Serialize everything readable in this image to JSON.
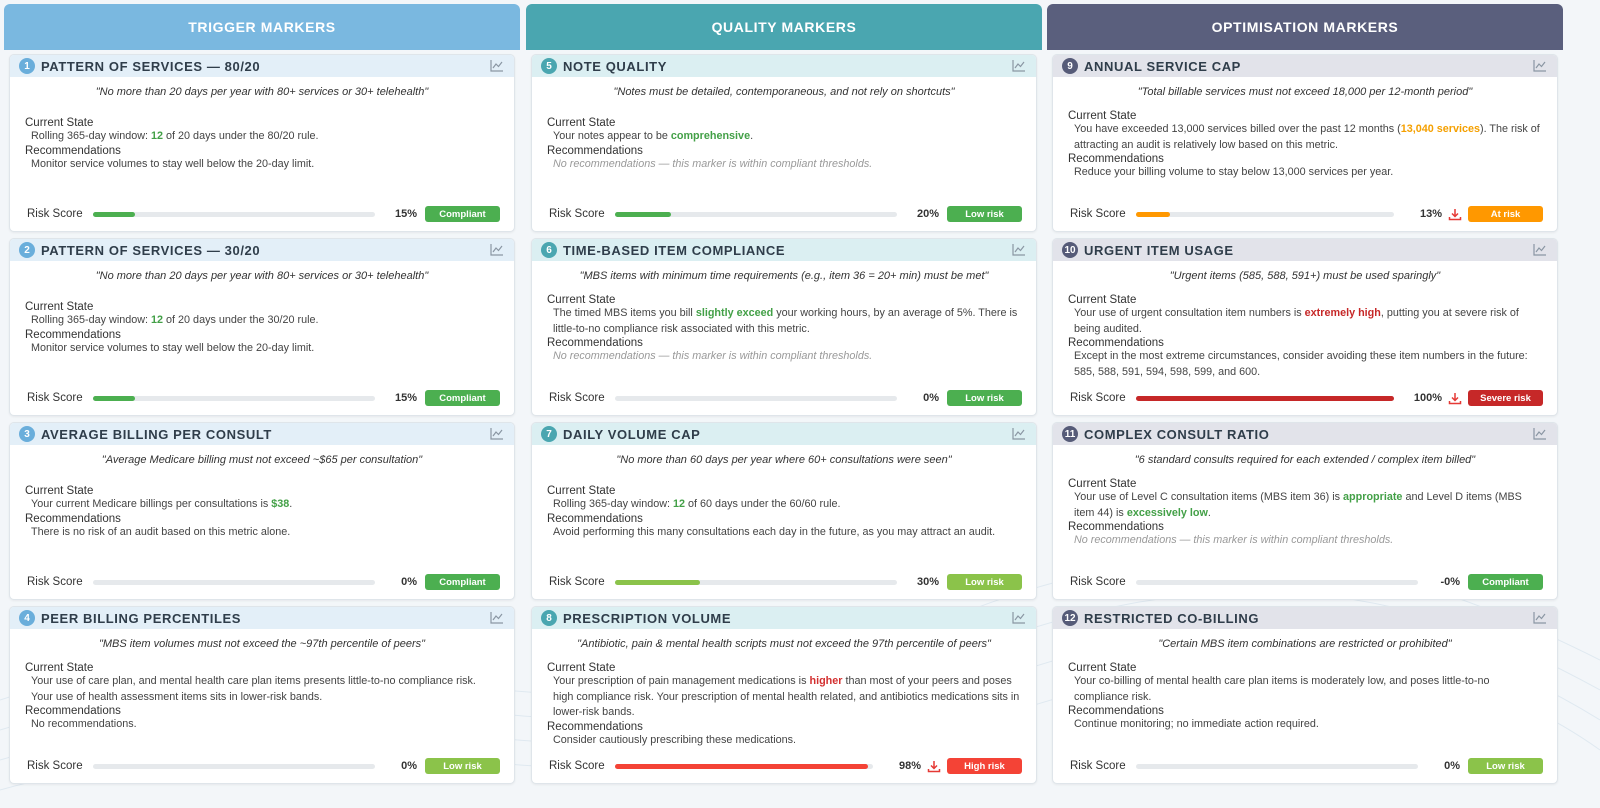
{
  "columns": [
    {
      "title": "TRIGGER MARKERS",
      "color": "#7ab8e0",
      "card_header_bg": "#e3eff8",
      "num_color": "#6aaedb"
    },
    {
      "title": "QUALITY MARKERS",
      "color": "#4aa6b0",
      "card_header_bg": "#dbeff2",
      "num_color": "#4aa6b0"
    },
    {
      "title": "OPTIMISATION MARKERS",
      "color": "#5a5f7d",
      "card_header_bg": "#e2e3ea",
      "num_color": "#565b78"
    }
  ],
  "labels": {
    "current_state": "Current State",
    "recommendations": "Recommendations",
    "risk_score": "Risk Score"
  },
  "colors": {
    "green": "#4caf50",
    "light_green": "#8bc34a",
    "orange": "#ff9800",
    "red": "#f44336",
    "dark_red": "#c62828"
  },
  "cards": [
    {
      "num": "1",
      "title": "PATTERN OF SERVICES — 80/20",
      "quote": "\"No more than 20 days per year with 80+ services or 30+ telehealth\"",
      "state": [
        {
          "t": "Rolling 365-day window: "
        },
        {
          "t": "12",
          "c": "green"
        },
        {
          "t": " of 20 days under the 80/20 rule."
        }
      ],
      "recs": "Monitor service volumes to stay well below the 20-day limit.",
      "recs_muted": false,
      "score": 15,
      "pct": "15%",
      "bar": "green",
      "badge": "Compliant",
      "badge_color": "green",
      "download": false
    },
    {
      "num": "2",
      "title": "PATTERN OF SERVICES — 30/20",
      "quote": "\"No more than 20 days per year with 80+ services or 30+ telehealth\"",
      "state": [
        {
          "t": "Rolling 365-day window: "
        },
        {
          "t": "12",
          "c": "green"
        },
        {
          "t": " of 20 days under the 30/20 rule."
        }
      ],
      "recs": "Monitor service volumes to stay well below the 20-day limit.",
      "recs_muted": false,
      "score": 15,
      "pct": "15%",
      "bar": "green",
      "badge": "Compliant",
      "badge_color": "green",
      "download": false
    },
    {
      "num": "3",
      "title": "AVERAGE BILLING PER CONSULT",
      "quote": "\"Average Medicare billing must not exceed ~$65 per consultation\"",
      "state": [
        {
          "t": "Your current Medicare billings per consultations is "
        },
        {
          "t": "$38",
          "c": "green"
        },
        {
          "t": "."
        }
      ],
      "recs": "There is no risk of an audit based on this metric alone.",
      "recs_muted": false,
      "score": 0,
      "pct": "0%",
      "bar": "green",
      "badge": "Compliant",
      "badge_color": "green",
      "download": false
    },
    {
      "num": "4",
      "title": "PEER BILLING PERCENTILES",
      "quote": "\"MBS item volumes must not exceed the ~97th percentile of peers\"",
      "state": [
        {
          "t": "Your use of care plan, and mental health care plan items presents little-to-no compliance risk. Your use of health assessment items sits in lower-risk bands."
        }
      ],
      "recs": "No recommendations.",
      "recs_muted": false,
      "score": 0,
      "pct": "0%",
      "bar": "light_green",
      "badge": "Low risk",
      "badge_color": "light_green",
      "download": false
    },
    {
      "num": "5",
      "title": "NOTE QUALITY",
      "quote": "\"Notes must be detailed, contemporaneous, and not rely on shortcuts\"",
      "state": [
        {
          "t": "Your notes appear to be "
        },
        {
          "t": "comprehensive",
          "c": "green"
        },
        {
          "t": "."
        }
      ],
      "recs": "No recommendations — this marker is within compliant thresholds.",
      "recs_muted": true,
      "score": 20,
      "pct": "20%",
      "bar": "green",
      "badge": "Low risk",
      "badge_color": "green",
      "download": false
    },
    {
      "num": "6",
      "title": "TIME-BASED ITEM COMPLIANCE",
      "quote": "\"MBS items with minimum time requirements (e.g., item 36 = 20+ min) must be met\"",
      "state": [
        {
          "t": "The timed MBS items you bill "
        },
        {
          "t": "slightly exceed",
          "c": "green"
        },
        {
          "t": " your working hours, by an average of 5%. There is little-to-no compliance risk associated with this metric."
        }
      ],
      "recs": "No recommendations — this marker is within compliant thresholds.",
      "recs_muted": true,
      "score": 0,
      "pct": "0%",
      "bar": "green",
      "badge": "Low risk",
      "badge_color": "green",
      "download": false
    },
    {
      "num": "7",
      "title": "DAILY VOLUME CAP",
      "quote": "\"No more than 60 days per year where 60+ consultations were seen\"",
      "state": [
        {
          "t": "Rolling 365-day window: "
        },
        {
          "t": "12",
          "c": "green"
        },
        {
          "t": " of 60 days under the 60/60 rule."
        }
      ],
      "recs": "Avoid performing this many consultations each day in the future, as you may attract an audit.",
      "recs_muted": false,
      "score": 30,
      "pct": "30%",
      "bar": "light_green",
      "badge": "Low risk",
      "badge_color": "light_green",
      "download": false
    },
    {
      "num": "8",
      "title": "PRESCRIPTION VOLUME",
      "quote": "\"Antibiotic, pain & mental health scripts must not exceed the 97th percentile of peers\"",
      "state": [
        {
          "t": "Your prescription of pain management medications is "
        },
        {
          "t": "higher",
          "c": "red"
        },
        {
          "t": " than most of your peers and poses high compliance risk. Your prescription of mental health related, and antibiotics medications sits in lower-risk bands."
        }
      ],
      "recs": "Consider cautiously prescribing these medications.",
      "recs_muted": false,
      "score": 98,
      "pct": "98%",
      "bar": "red",
      "badge": "High risk",
      "badge_color": "red",
      "download": true
    },
    {
      "num": "9",
      "title": "ANNUAL SERVICE CAP",
      "quote": "\"Total billable services must not exceed 18,000 per 12-month period\"",
      "state": [
        {
          "t": "You have exceeded 13,000 services billed over the past 12 months ("
        },
        {
          "t": "13,040 services",
          "c": "orange"
        },
        {
          "t": "). The risk of attracting an audit is relatively low based on this metric."
        }
      ],
      "recs": "Reduce your billing volume to stay below 13,000 services per year.",
      "recs_muted": false,
      "score": 13,
      "pct": "13%",
      "bar": "orange",
      "badge": "At risk",
      "badge_color": "orange",
      "download": true
    },
    {
      "num": "10",
      "title": "URGENT ITEM USAGE",
      "quote": "\"Urgent items (585, 588, 591+) must be used sparingly\"",
      "state": [
        {
          "t": "Your use of urgent consultation item numbers is "
        },
        {
          "t": "extremely high",
          "c": "dark_red"
        },
        {
          "t": ", putting you at severe risk of being audited."
        }
      ],
      "recs": "Except in the most extreme circumstances, consider avoiding these item numbers in the future: 585, 588, 591, 594, 598, 599, and 600.",
      "recs_muted": false,
      "score": 100,
      "pct": "100%",
      "bar": "dark_red",
      "badge": "Severe risk",
      "badge_color": "dark_red",
      "download": true
    },
    {
      "num": "11",
      "title": "COMPLEX CONSULT RATIO",
      "quote": "\"6 standard consults required for each extended / complex item billed\"",
      "state": [
        {
          "t": "Your use of Level C consultation items (MBS item 36) is "
        },
        {
          "t": "appropriate",
          "c": "green"
        },
        {
          "t": " and Level D items (MBS item 44) is "
        },
        {
          "t": "excessively low",
          "c": "green"
        },
        {
          "t": "."
        }
      ],
      "recs": "No recommendations — this marker is within compliant thresholds.",
      "recs_muted": true,
      "score": 0,
      "pct": "-0%",
      "bar": "green",
      "badge": "Compliant",
      "badge_color": "green",
      "download": false
    },
    {
      "num": "12",
      "title": "RESTRICTED CO-BILLING",
      "quote": "\"Certain MBS item combinations are restricted or prohibited\"",
      "state": [
        {
          "t": "Your co-billing of mental health care plan items is moderately low, and poses little-to-no compliance risk."
        }
      ],
      "recs": "Continue monitoring; no immediate action required.",
      "recs_muted": false,
      "score": 0,
      "pct": "0%",
      "bar": "light_green",
      "badge": "Low risk",
      "badge_color": "light_green",
      "download": false
    }
  ]
}
